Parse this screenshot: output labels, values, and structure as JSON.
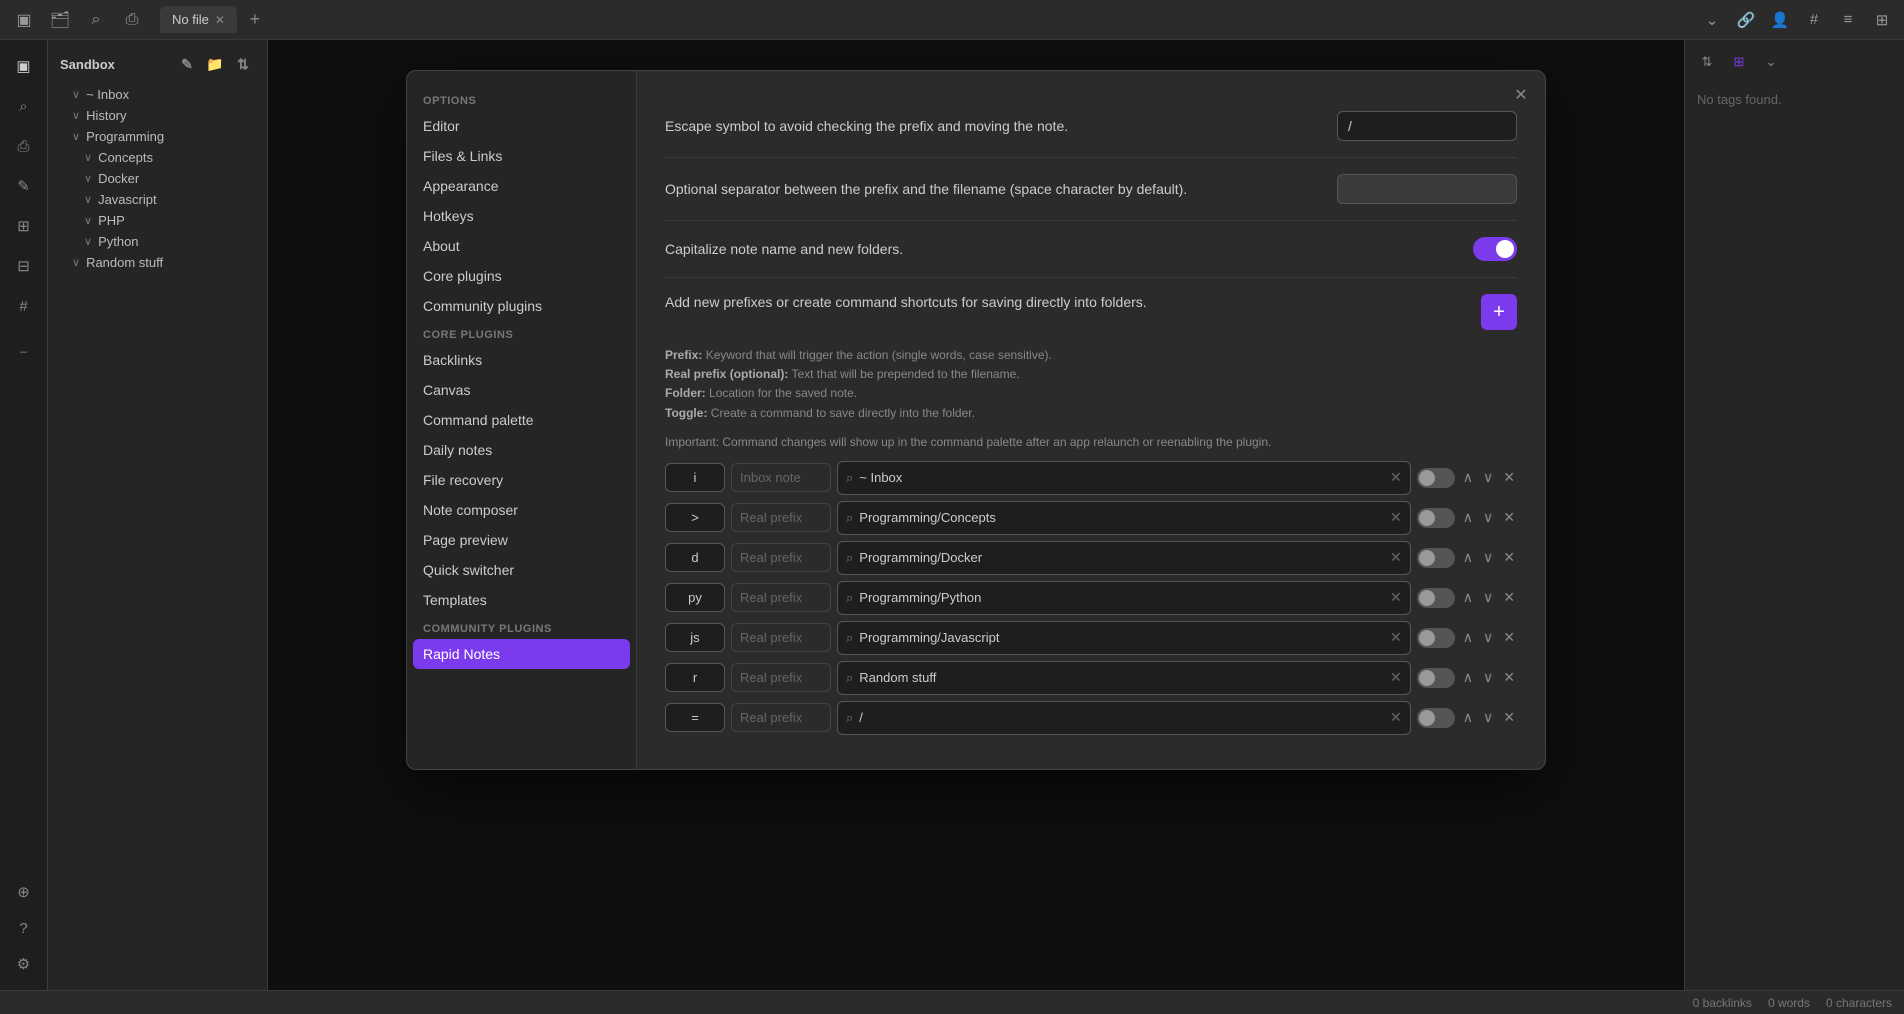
{
  "topBar": {
    "tabLabel": "No file",
    "icons": {
      "sidebar": "▣",
      "folder": "🗂",
      "search": "⌕",
      "bookmark": "⌖",
      "add": "+",
      "chevronDown": "⌄",
      "link": "🔗",
      "person": "👤",
      "hash": "#",
      "hamburger": "≡",
      "layout": "⊞"
    }
  },
  "leftStrip": {
    "icons": [
      {
        "name": "files-icon",
        "glyph": "▣"
      },
      {
        "name": "search-icon",
        "glyph": "⌕"
      },
      {
        "name": "bookmark-icon",
        "glyph": "⌖"
      },
      {
        "name": "edit-icon",
        "glyph": "✎"
      },
      {
        "name": "folder-icon",
        "glyph": "⊞"
      },
      {
        "name": "grid-icon",
        "glyph": "⊟"
      },
      {
        "name": "tag-icon",
        "glyph": "#"
      },
      {
        "name": "terminal-icon",
        "glyph": ">_"
      }
    ],
    "bottomIcons": [
      {
        "name": "plugin-icon",
        "glyph": "⊕"
      },
      {
        "name": "help-icon",
        "glyph": "?"
      },
      {
        "name": "settings-icon",
        "glyph": "⚙"
      }
    ]
  },
  "fileTree": {
    "vaultName": "Sandbox",
    "items": [
      {
        "label": "~ Inbox",
        "indent": 1,
        "hasChevron": true
      },
      {
        "label": "History",
        "indent": 1,
        "hasChevron": true
      },
      {
        "label": "Programming",
        "indent": 1,
        "hasChevron": true
      },
      {
        "label": "Concepts",
        "indent": 2,
        "hasChevron": true
      },
      {
        "label": "Docker",
        "indent": 2,
        "hasChevron": true
      },
      {
        "label": "Javascript",
        "indent": 2,
        "hasChevron": true
      },
      {
        "label": "PHP",
        "indent": 2,
        "hasChevron": true
      },
      {
        "label": "Python",
        "indent": 2,
        "hasChevron": true
      },
      {
        "label": "Random stuff",
        "indent": 1,
        "hasChevron": true
      }
    ]
  },
  "modal": {
    "closeBtn": "✕",
    "sidebar": {
      "optionsLabel": "Options",
      "navItems": [
        {
          "label": "Editor",
          "active": false
        },
        {
          "label": "Files & Links",
          "active": false
        },
        {
          "label": "Appearance",
          "active": false
        },
        {
          "label": "Hotkeys",
          "active": false
        },
        {
          "label": "About",
          "active": false
        },
        {
          "label": "Core plugins",
          "active": false
        },
        {
          "label": "Community plugins",
          "active": false
        }
      ],
      "corePluginsLabel": "Core plugins",
      "corePlugins": [
        {
          "label": "Backlinks",
          "active": false
        },
        {
          "label": "Canvas",
          "active": false
        },
        {
          "label": "Command palette",
          "active": false
        },
        {
          "label": "Daily notes",
          "active": false
        },
        {
          "label": "File recovery",
          "active": false
        },
        {
          "label": "Note composer",
          "active": false
        },
        {
          "label": "Page preview",
          "active": false
        },
        {
          "label": "Quick switcher",
          "active": false
        },
        {
          "label": "Templates",
          "active": false
        }
      ],
      "communityPluginsLabel": "Community plugins",
      "communityPlugins": [
        {
          "label": "Rapid Notes",
          "active": true
        }
      ]
    },
    "content": {
      "settings": [
        {
          "label": "Escape symbol to avoid checking the prefix and moving the note.",
          "type": "input",
          "value": "/"
        },
        {
          "label": "Optional separator between the prefix and the filename (space character by default).",
          "type": "input-gray",
          "value": ""
        },
        {
          "label": "Capitalize note name and new folders.",
          "type": "toggle",
          "value": true
        }
      ],
      "addPrefixLabel": "Add new prefixes or create command shortcuts for saving directly into folders.",
      "addPrefixBtn": "+",
      "descText": {
        "prefix": "Prefix:",
        "prefixDesc": " Keyword that will trigger the action (single words, case sensitive).",
        "realPrefix": "Real prefix (optional):",
        "realPrefixDesc": " Text that will be prepended to the filename.",
        "folder": "Folder:",
        "folderDesc": " Location for the saved note.",
        "toggle": "Toggle:",
        "toggleDesc": " Create a command to save directly into the folder."
      },
      "importantNote": "Important: Command changes will show up in the command palette after an app relaunch or reenabling the plugin.",
      "prefixRows": [
        {
          "key": "i",
          "realPrefix": "",
          "realPlaceholder": "Inbox note",
          "folder": "~ Inbox",
          "toggleOn": false
        },
        {
          "key": ">",
          "realPrefix": "",
          "realPlaceholder": "Real prefix",
          "folder": "Programming/Concepts",
          "toggleOn": false
        },
        {
          "key": "d",
          "realPrefix": "",
          "realPlaceholder": "Real prefix",
          "folder": "Programming/Docker",
          "toggleOn": false
        },
        {
          "key": "py",
          "realPrefix": "",
          "realPlaceholder": "Real prefix",
          "folder": "Programming/Python",
          "toggleOn": false
        },
        {
          "key": "js",
          "realPrefix": "",
          "realPlaceholder": "Real prefix",
          "folder": "Programming/Javascript",
          "toggleOn": false
        },
        {
          "key": "r",
          "realPrefix": "",
          "realPlaceholder": "Real prefix",
          "folder": "Random stuff",
          "toggleOn": false
        },
        {
          "key": "=",
          "realPrefix": "",
          "realPlaceholder": "Real prefix",
          "folder": "/",
          "toggleOn": false
        }
      ]
    }
  },
  "rightPanel": {
    "noTagsText": "No tags found.",
    "icons": [
      "⇅",
      "⊞",
      "⌄"
    ]
  },
  "statusBar": {
    "backlinks": "0 backlinks",
    "words": "0 words",
    "chars": "0 characters"
  }
}
